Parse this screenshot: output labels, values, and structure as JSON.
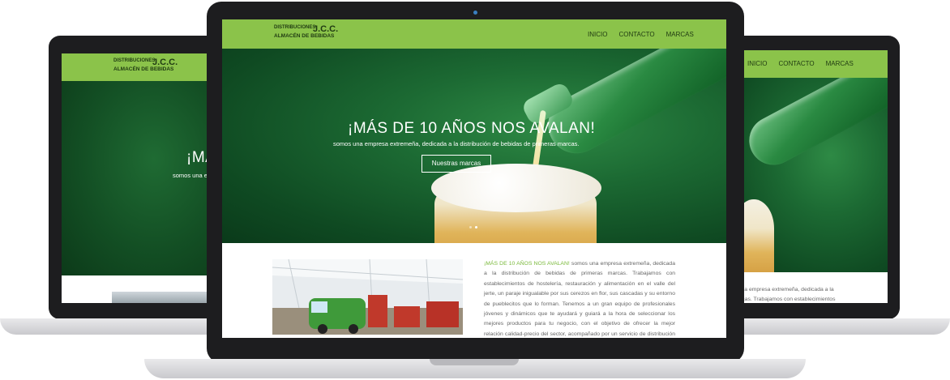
{
  "site": {
    "logo": {
      "line1": "DISTRIBUCIONES",
      "line2": "J.C.C.",
      "line3": "ALMACÉN DE BEBIDAS"
    },
    "nav": [
      "INICIO",
      "CONTACTO",
      "MARCAS"
    ],
    "hero": {
      "title": "¡MÁS DE 10 AÑOS NOS AVALAN!",
      "title_left_fragment": "¡MÁ",
      "subtitle": "somos una empresa extremeña, dedicada a la distribución de bebidas de primeras marcas.",
      "subtitle_left_fragment": "somos una e",
      "button": "Nuestras marcas",
      "slides": 2,
      "active_slide": 2
    },
    "about": {
      "highlight": "¡MÁS DE 10 AÑOS NOS AVALAN!",
      "text": " somos una empresa extremeña, dedicada a la distribución de bebidas de primeras marcas. Trabajamos con establecimientos de hostelería, restauración y alimentación en el valle del jerte, un paraje inigualable por sus cerezos en flor, sus cascadas y su entorno de pueblecitos que lo forman. Tenemos a un gran equipo de profesionales jóvenes y dinámicos que te ayudará y guiará a la hora de seleccionar los mejores productos para tu negocio, con el objetivo de ofrecer la mejor relación calidad-precio del sector, acompañado por un servicio de distribución y entrega de mercancías eficaz",
      "right_fragment_line1": "ina empresa extremeña, dedicada a la",
      "right_fragment_line2": "rcas. Trabajamos con establecimientos"
    },
    "colors": {
      "brand_green": "#8bc34a",
      "highlight_green": "#7ab93a",
      "hero_green": "#1c6a33"
    }
  }
}
